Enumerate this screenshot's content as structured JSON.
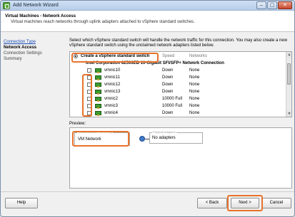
{
  "window": {
    "title": "Add Network Wizard",
    "buttons": [
      "–",
      "▢",
      "✕"
    ]
  },
  "header": {
    "title": "Virtual Machines - Network Access",
    "description": "Virtual machines reach networks through uplink adapters attached to vSphere standard switches."
  },
  "steps": [
    {
      "label": "Connection Type"
    },
    {
      "label": "Network Access"
    },
    {
      "label": "Connection Settings"
    },
    {
      "label": "Summary"
    }
  ],
  "intro": "Select which vSphere standard switch will handle the network traffic for this connection. You may also create a new vSphere standard switch using the unclaimed network adapters listed below.",
  "list": {
    "create_label": "Create a vSphere standard switch",
    "col_speed": "Speed",
    "col_networks": "Networks",
    "group_label": "Intel Corporation 82599EB 10-Gigabit SFI/SFP+ Network Connection",
    "nics": [
      {
        "name": "vmnic10",
        "speed": "Down",
        "networks": "None"
      },
      {
        "name": "vmnic11",
        "speed": "Down",
        "networks": "None"
      },
      {
        "name": "vmnic12",
        "speed": "Down",
        "networks": "None"
      },
      {
        "name": "vmnic13",
        "speed": "Down",
        "networks": "None"
      },
      {
        "name": "vmnic2",
        "speed": "10000 Full",
        "networks": "None"
      },
      {
        "name": "vmnic3",
        "speed": "10000 Full",
        "networks": "None"
      },
      {
        "name": "vmnic4",
        "speed": "Down",
        "networks": "None"
      }
    ]
  },
  "preview": {
    "label": "Preview:",
    "vm_group_caption": "Virtual Machine Port Group",
    "vm_network": "VM Network",
    "physical_caption": "Physical Adapters",
    "no_adapters": "No adapters"
  },
  "footer": {
    "help": "Help",
    "back": "< Back",
    "next": "Next >",
    "cancel": "Cancel"
  },
  "colors": {
    "highlight": "#e8732b",
    "nic_icon": "#3c9a2e",
    "link": "#1a4db5"
  }
}
